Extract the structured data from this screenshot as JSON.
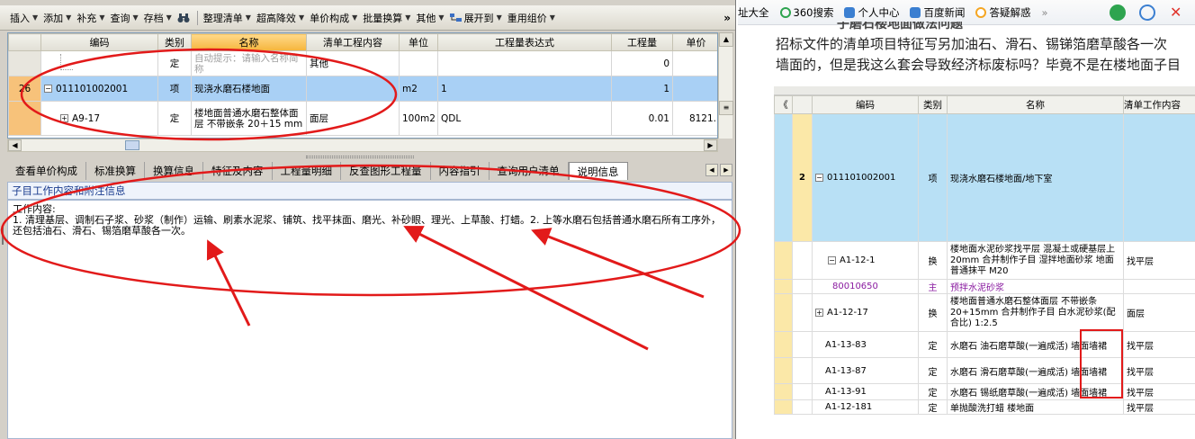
{
  "toolbar": {
    "items": [
      "插入",
      "添加",
      "补充",
      "查询",
      "存档",
      "整理清单",
      "超高降效",
      "单价构成",
      "批量换算",
      "其他",
      "展开到",
      "重用组价"
    ],
    "more": "»"
  },
  "grid": {
    "headers": [
      "编码",
      "类别",
      "名称",
      "清单工程内容",
      "单位",
      "工程量表达式",
      "工程量",
      "单价"
    ],
    "rows": [
      {
        "rn": "",
        "code": "",
        "type": "定",
        "name": "自动提示：请输入名称简称",
        "content": "其他",
        "unit": "",
        "expr": "",
        "qty": "0",
        "price": ""
      },
      {
        "rn": "26",
        "code": "011101002001",
        "type": "项",
        "name": "现浇水磨石楼地面",
        "content": "",
        "unit": "m2",
        "expr": "1",
        "qty": "1",
        "price": ""
      },
      {
        "rn": "",
        "code": "A9-17",
        "type": "定",
        "name": "楼地面普通水磨石整体面层 不带嵌条 20＋15 mm",
        "content": "面层",
        "unit": "100m2",
        "expr": "QDL",
        "qty": "0.01",
        "price": "8121."
      }
    ]
  },
  "tabs": [
    "查看单价构成",
    "标准换算",
    "换算信息",
    "特征及内容",
    "工程量明细",
    "反查图形工程量",
    "内容指引",
    "查询用户清单",
    "说明信息"
  ],
  "info": {
    "title": "子目工作内容和附注信息",
    "label": "工作内容:",
    "text": "1. 清理基层、调制石子浆、砂浆（制作）运输、刷素水泥浆、铺筑、找平抹面、磨光、补砂眼、理光、上草酸、打蜡。2. 上等水磨石包括普通水磨石所有工序外，还包括油石、滑石、锡箔磨草酸各一次。"
  },
  "browser": {
    "bookmarks": [
      "址大全",
      "360搜索",
      "个人中心",
      "百度新闻",
      "答疑解惑"
    ],
    "more": "»"
  },
  "page": {
    "heading_partial": "子磨石楼地面做法问题",
    "text_line1": "招标文件的清单项目特征写另加油石、滑石、锡锑箔磨草酸各一次",
    "text_line2": "墙面的，但是我这么套会导致经济标废标吗？毕竟不是在楼地面子目"
  },
  "rgrid": {
    "headers": [
      "",
      "编码",
      "类别",
      "名称",
      "清单工作内容"
    ],
    "rows": [
      {
        "rn": "2",
        "code": "011101002001",
        "type": "项",
        "name": "现浇水磨石楼地面/地下室",
        "content": "",
        "box": "minus"
      },
      {
        "rn": "",
        "code": "A1-12-1",
        "type": "换",
        "name": "楼地面水泥砂浆找平层 混凝土或硬基层上 20mm  合并制作子目 湿拌地面砂浆 地面普通抹平 M20",
        "content": "找平层",
        "box": "minus"
      },
      {
        "rn": "",
        "code": "80010650",
        "type": "主",
        "name": "预拌水泥砂浆",
        "content": "",
        "box": "",
        "purple": true
      },
      {
        "rn": "",
        "code": "A1-12-17",
        "type": "换",
        "name": "楼地面普通水磨石整体面层 不带嵌条 20+15mm  合并制作子目 白水泥砂浆(配合比) 1:2.5",
        "content": "面层",
        "box": "plus"
      },
      {
        "rn": "",
        "code": "A1-13-83",
        "type": "定",
        "name": "水磨石 油石磨草酸(一遍成活)",
        "extra": "墙面墙裙",
        "content": "找平层",
        "box": ""
      },
      {
        "rn": "",
        "code": "A1-13-87",
        "type": "定",
        "name": "水磨石 滑石磨草酸(一遍成活)",
        "extra": "墙面墙裙",
        "content": "找平层",
        "box": ""
      },
      {
        "rn": "",
        "code": "A1-13-91",
        "type": "定",
        "name": "水磨石 锡纸磨草酸(一遍成活)",
        "extra": "墙面墙裙",
        "content": "找平层",
        "box": ""
      },
      {
        "rn": "",
        "code": "A1-12-181",
        "type": "定",
        "name": "单抛酸洗打蜡 楼地面",
        "content": "找平层",
        "box": ""
      }
    ]
  },
  "colors": {
    "annotation": "#e21a1a",
    "selected_row": "#a9d0f5",
    "header_highlight": "#f5b53b"
  }
}
